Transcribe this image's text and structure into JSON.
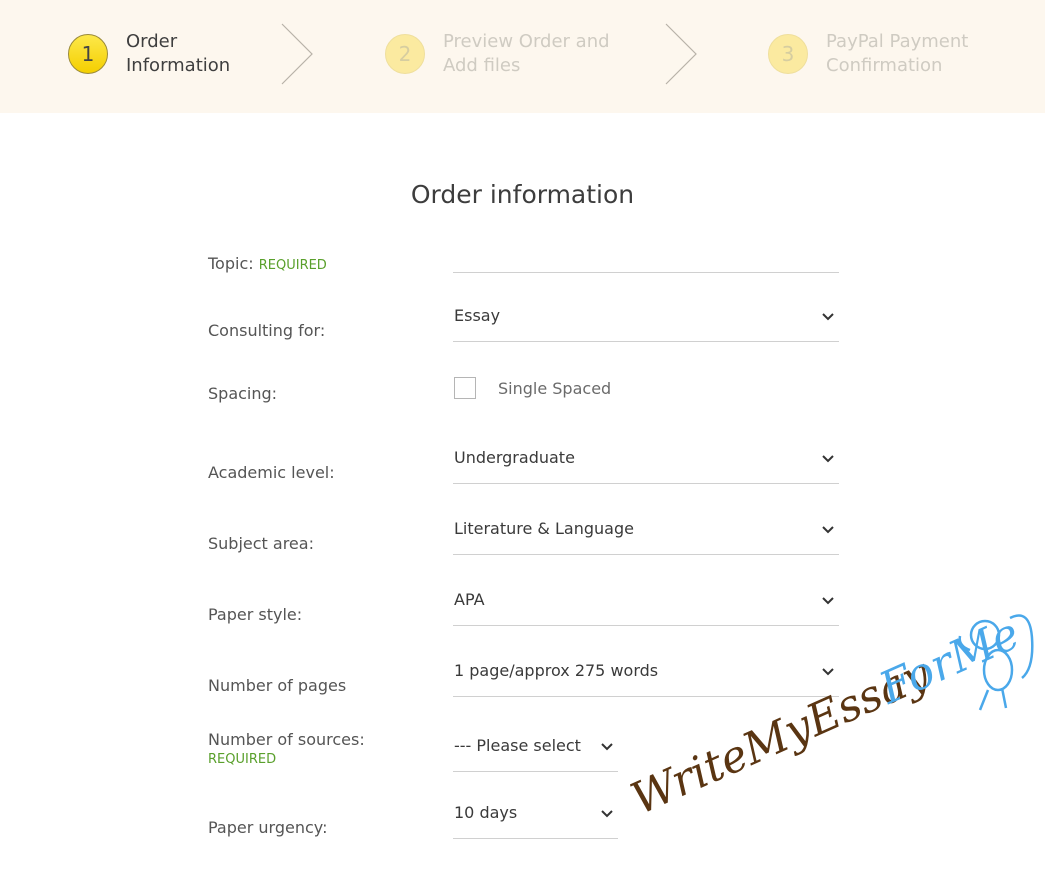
{
  "stepper": {
    "steps": [
      {
        "number": "1",
        "line1": "Order",
        "line2": "Information",
        "state": "active"
      },
      {
        "number": "2",
        "line1": "Preview Order and",
        "line2": "Add files",
        "state": "inactive"
      },
      {
        "number": "3",
        "line1": "PayPal Payment",
        "line2": "Confirmation",
        "state": "inactive"
      }
    ]
  },
  "form": {
    "title": "Order information",
    "required_tag": "REQUIRED",
    "topic": {
      "label": "Topic:",
      "value": ""
    },
    "consulting_for": {
      "label": "Consulting for:",
      "value": "Essay"
    },
    "spacing": {
      "label": "Spacing:",
      "option_label": "Single Spaced",
      "checked": false
    },
    "academic_level": {
      "label": "Academic level:",
      "value": "Undergraduate"
    },
    "subject_area": {
      "label": "Subject area:",
      "value": "Literature & Language"
    },
    "paper_style": {
      "label": "Paper style:",
      "value": "APA"
    },
    "number_of_pages": {
      "label": "Number of pages",
      "value": "1 page/approx 275 words"
    },
    "number_of_sources": {
      "label": "Number of sources:",
      "value": "--- Please select"
    },
    "paper_urgency": {
      "label": "Paper urgency:",
      "value": "10 days"
    }
  },
  "watermark": {
    "part1": "WriteMyEssay",
    "part2": "ForMe",
    "color1": "#5a3512",
    "color2": "#4aa8ea"
  },
  "colors": {
    "accent_yellow": "#f7d80e",
    "required_green": "#5aa02c",
    "header_bg": "#fdf7ee"
  }
}
